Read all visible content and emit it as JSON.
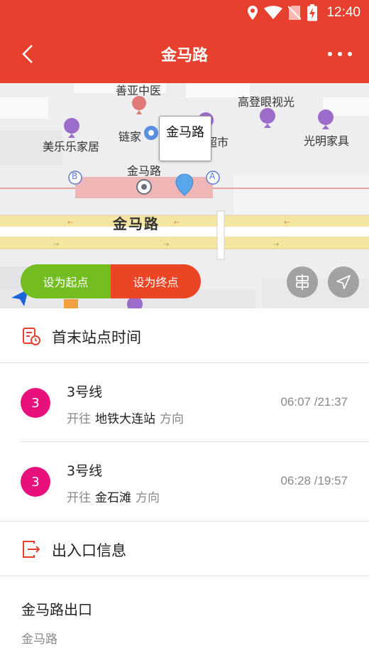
{
  "status_bar": {
    "time": "12:40"
  },
  "app_bar": {
    "title": "金马路"
  },
  "map": {
    "pois": {
      "chinese_medicine": "善亚中医",
      "optical": "高登眼视光",
      "furniture_left": "美乐乐家居",
      "chain": "链家",
      "supermarket": "超市",
      "furniture_right": "光明家具",
      "station": "金马路",
      "exit_b": "B",
      "exit_a": "A"
    },
    "road_name": "金马路",
    "callout": "金马路"
  },
  "actions": {
    "set_start": "设为起点",
    "set_end": "设为终点"
  },
  "timetable": {
    "title": "首末站点时间",
    "lines": [
      {
        "badge": "3",
        "name": "3号线",
        "prefix": "开往",
        "destination": "地铁大连站",
        "suffix": "方向",
        "times": "06:07 /21:37"
      },
      {
        "badge": "3",
        "name": "3号线",
        "prefix": "开往",
        "destination": "金石滩",
        "suffix": "方向",
        "times": "06:28 /19:57"
      }
    ]
  },
  "exits": {
    "title": "出入口信息",
    "items": [
      {
        "name": "金马路出口",
        "sub": "金马路"
      }
    ]
  },
  "colors": {
    "primary_red": "#e8402f",
    "line3": "#e8107a",
    "start_green": "#74bd20",
    "end_red": "#ea4524"
  }
}
